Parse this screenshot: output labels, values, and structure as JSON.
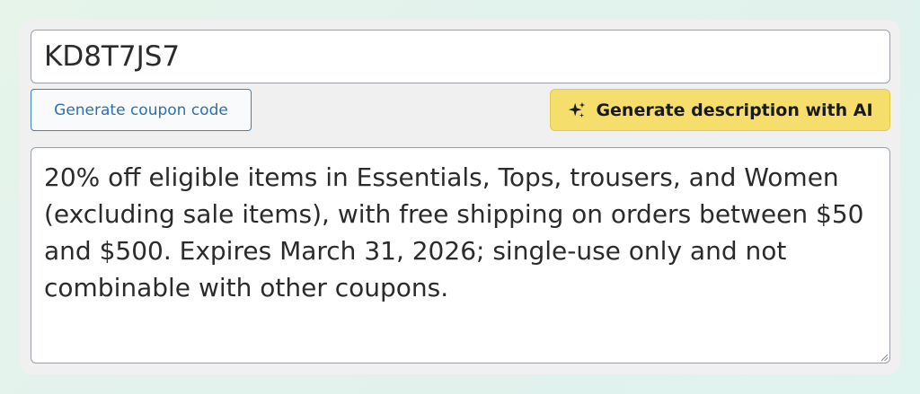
{
  "coupon": {
    "code_value": "KD8T7JS7"
  },
  "buttons": {
    "generate_code_label": "Generate coupon code",
    "generate_description_label": "Generate description with AI",
    "ai_icon": "sparkles-icon"
  },
  "description": {
    "value": "20% off eligible items in Essentials, Tops, trousers, and Women (excluding sale items), with free shipping on orders between $50 and $500. Expires March 31, 2026; single-use only and not combinable with other coupons."
  },
  "colors": {
    "ai_button_bg": "#f5de6c",
    "code_button_border": "#3b82c4",
    "panel_bg": "#f0f0f1"
  }
}
